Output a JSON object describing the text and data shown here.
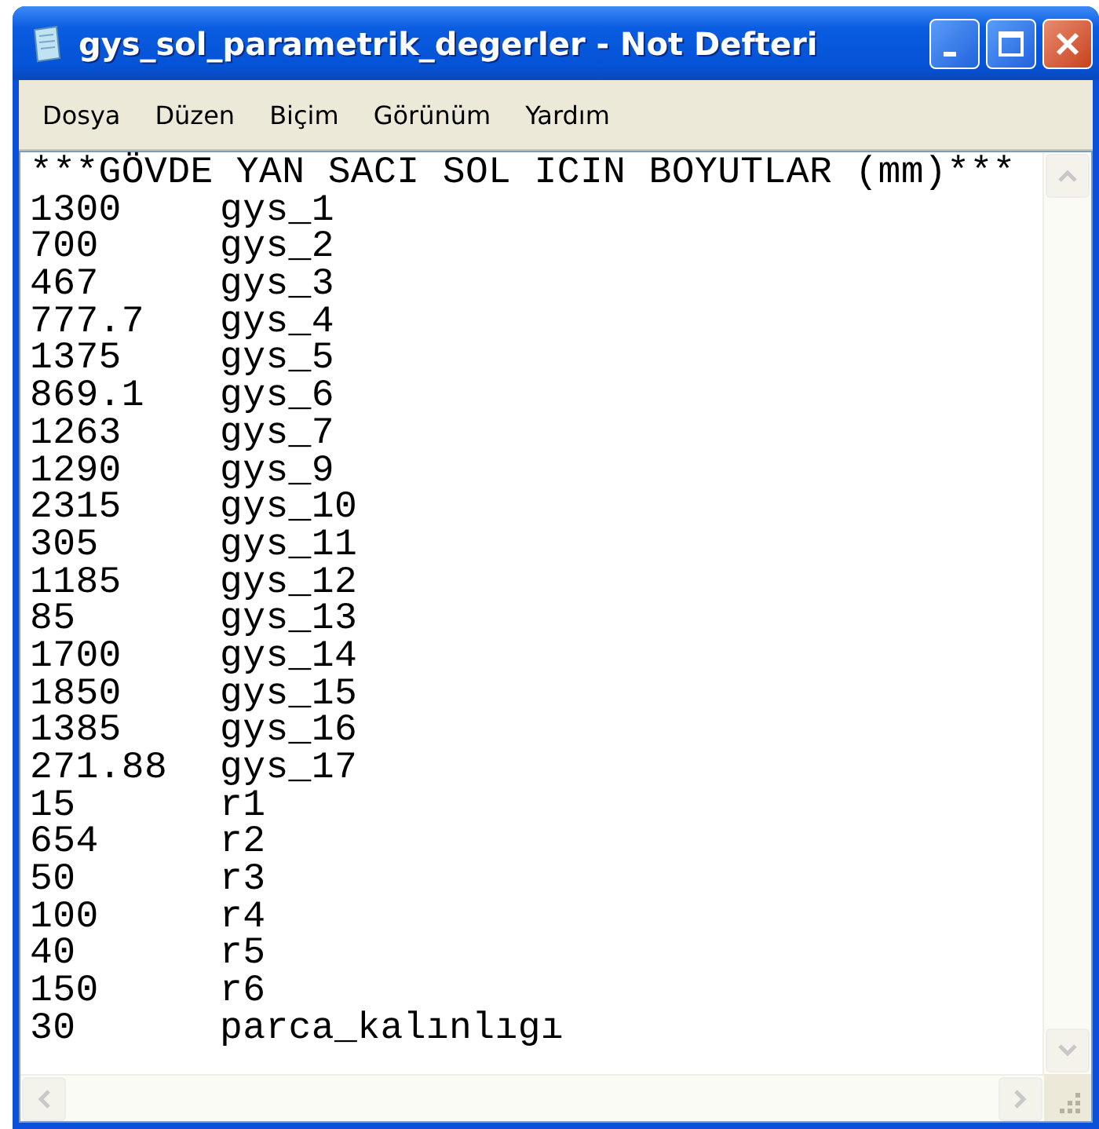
{
  "window": {
    "title": "gys_sol_parametrik_degerler - Not Defteri"
  },
  "menu": [
    "Dosya",
    "Düzen",
    "Biçim",
    "Görünüm",
    "Yardım"
  ],
  "editor": {
    "heading": "***GÖVDE YAN SACI SOL ICIN BOYUTLAR (mm)***",
    "lines": [
      {
        "value": "1300",
        "name": "gys_1"
      },
      {
        "value": "700",
        "name": "gys_2"
      },
      {
        "value": "467",
        "name": "gys_3"
      },
      {
        "value": "777.7",
        "name": "gys_4"
      },
      {
        "value": "1375",
        "name": "gys_5"
      },
      {
        "value": "869.1",
        "name": "gys_6"
      },
      {
        "value": "1263",
        "name": "gys_7"
      },
      {
        "value": "1290",
        "name": "gys_9"
      },
      {
        "value": "2315",
        "name": "gys_10"
      },
      {
        "value": "305",
        "name": "gys_11"
      },
      {
        "value": "1185",
        "name": "gys_12"
      },
      {
        "value": "85",
        "name": "gys_13"
      },
      {
        "value": "1700",
        "name": "gys_14"
      },
      {
        "value": "1850",
        "name": "gys_15"
      },
      {
        "value": "1385",
        "name": "gys_16"
      },
      {
        "value": "271.88",
        "name": "gys_17"
      },
      {
        "value": "15",
        "name": "r1"
      },
      {
        "value": "654",
        "name": "r2"
      },
      {
        "value": "50",
        "name": "r3"
      },
      {
        "value": "100",
        "name": "r4"
      },
      {
        "value": "40",
        "name": "r5"
      },
      {
        "value": "150",
        "name": "r6"
      },
      {
        "value": "30",
        "name": "parca_kalınlıgı"
      }
    ]
  }
}
